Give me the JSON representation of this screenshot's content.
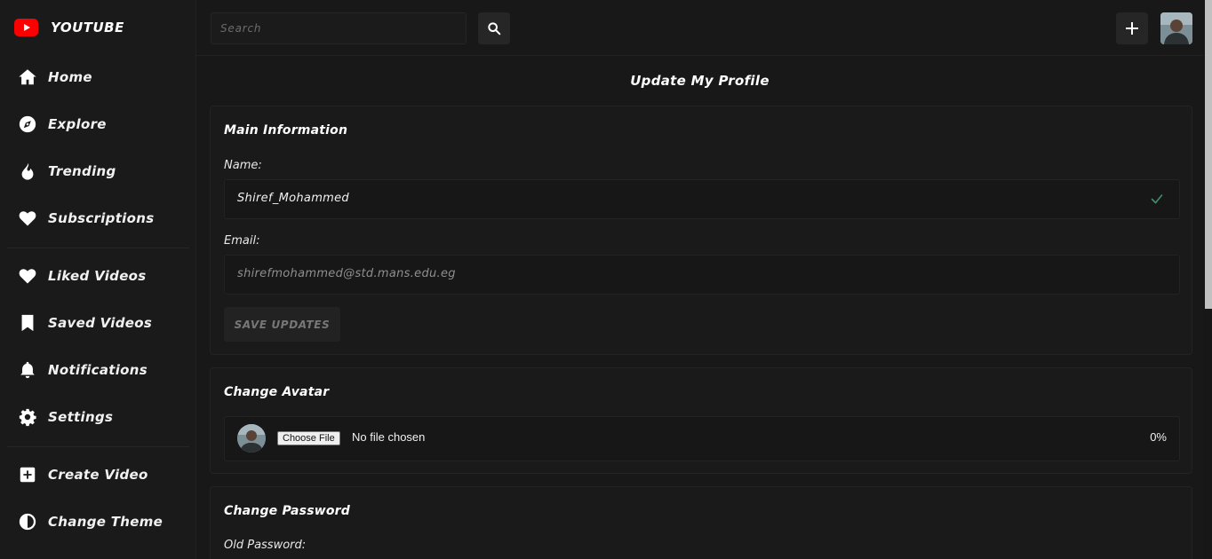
{
  "brand": {
    "name": "YOUTUBE",
    "logo_icon": "youtube-logo-icon",
    "accent": "#ff0000"
  },
  "sidebar": {
    "items": [
      {
        "label": "Home",
        "icon": "home-icon"
      },
      {
        "label": "Explore",
        "icon": "compass-icon"
      },
      {
        "label": "Trending",
        "icon": "fire-icon"
      },
      {
        "label": "Subscriptions",
        "icon": "heart-icon"
      },
      {
        "label": "Liked Videos",
        "icon": "heart-icon"
      },
      {
        "label": "Saved Videos",
        "icon": "bookmark-icon"
      },
      {
        "label": "Notifications",
        "icon": "bell-icon"
      },
      {
        "label": "Settings",
        "icon": "gear-icon"
      },
      {
        "label": "Create Video",
        "icon": "plus-square-icon"
      },
      {
        "label": "Change Theme",
        "icon": "half-circle-icon"
      }
    ]
  },
  "topbar": {
    "search_placeholder": "Search",
    "search_icon": "search-icon",
    "add_icon": "plus-icon"
  },
  "main": {
    "title": "Update My Profile",
    "main_info": {
      "title": "Main Information",
      "name_label": "Name:",
      "name_value": "Shiref_Mohammed",
      "email_label": "Email:",
      "email_value": "shirefmohammed@std.mans.edu.eg",
      "save_label": "SAVE UPDATES"
    },
    "avatar": {
      "title": "Change Avatar",
      "choose_label": "Choose File",
      "no_file": "No file chosen",
      "progress": "0%"
    },
    "password": {
      "title": "Change Password",
      "old_label": "Old Password:"
    }
  },
  "colors": {
    "background": "#181818",
    "surface": "#1a1a1a",
    "check": "#3f8f6a"
  }
}
